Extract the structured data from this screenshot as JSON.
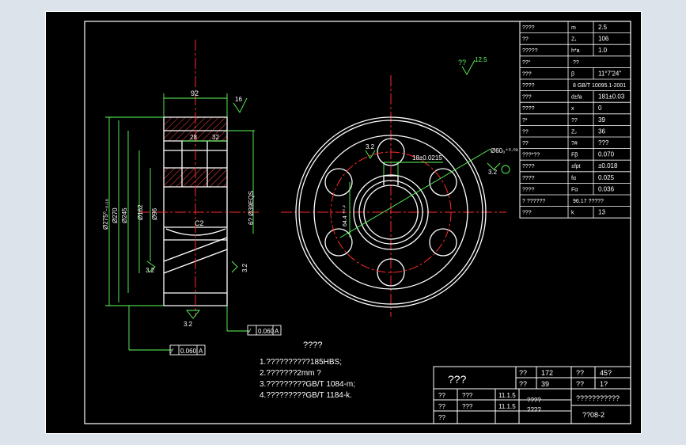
{
  "colors": {
    "background": "#000000",
    "outline": "#ffffff",
    "dimension": "#5cff5c",
    "centerline": "#ff2a2a",
    "canvas": "#dde3ea"
  },
  "params": {
    "rows": [
      {
        "label": "????",
        "sym": "m",
        "val": "2.5"
      },
      {
        "label": "??",
        "sym": "Z₁",
        "val": "106"
      },
      {
        "label": "?????",
        "sym": "h*a",
        "val": "1.0"
      },
      {
        "label": "??°",
        "sym": "",
        "val": "??"
      },
      {
        "label": "???",
        "sym": "β",
        "val": "11°7'24\""
      },
      {
        "label": "????",
        "sym": "",
        "val": "8 GB/T 10095.1-2001"
      },
      {
        "label": "???",
        "sym": "d±fa",
        "val": "181±0.03"
      },
      {
        "label": "????",
        "sym": "x",
        "val": "0"
      },
      {
        "label": "?*",
        "sym": "??",
        "val": "39"
      },
      {
        "label": "??",
        "sym": "Z₂",
        "val": "36"
      },
      {
        "label": "??",
        "sym": "?#",
        "val": "???"
      },
      {
        "label": "???*??",
        "sym": "Fβ",
        "val": "0.070"
      },
      {
        "label": "????",
        "sym": "±fpt",
        "val": "±0.018"
      },
      {
        "label": "????",
        "sym": "fα",
        "val": "0.025"
      },
      {
        "label": "????",
        "sym": "Fα",
        "val": "0.036"
      },
      {
        "label": "? ??????",
        "sym": "",
        "val": "96.17 ?????"
      },
      {
        "label": "???",
        "sym": "k",
        "val": "13"
      }
    ]
  },
  "dims": {
    "width_92": "92",
    "d16": "16",
    "d28": "28",
    "d32": "32",
    "dia_275": "Ø275⁰₋₀.₂₉",
    "dia_270": "Ø270",
    "dia_245": "Ø245",
    "dia_162": "Ø162",
    "dia_96": "Ø96",
    "dia_60": "Ø60₀⁺⁰·⁰³",
    "bore_label": "Ø39.05 EQS",
    "c2": "C2",
    "slot": "18±0.0215",
    "rough_32_a": "3.2",
    "rough_32_b": "3.2",
    "rough_32_c": "3.2",
    "rough_32_d": "3.2",
    "rough_32_e": "3.2",
    "rough_125": "12.5",
    "rough_top": "??",
    "fcf_1": "0.060",
    "fcf_a1": "A",
    "fcf_2": "0.060",
    "fcf_a2": "A",
    "tol_64": "64.4 ⁺⁰·²",
    "h6": "6? Ø39EQS"
  },
  "notes": {
    "title": "????",
    "items": [
      "1.??????????185HBS;",
      "2.???????2mm ?",
      "3.?????????GB/T 1084-m;",
      "4.?????????GB/T 1184-k."
    ]
  },
  "titleblock": {
    "name": "???",
    "c1": "??",
    "c2": "172",
    "c3": "??",
    "c4": "45?",
    "c5": "??",
    "c6": "39",
    "c7": "??",
    "c8": "1?",
    "r1a": "??",
    "r1b": "???",
    "r1c": "11.1.5",
    "r2a": "??",
    "r2b": "???",
    "r2c": "11.1.5",
    "r3a": "??",
    "school_a": "????",
    "school_b": "????",
    "drawing_name": "???????????",
    "drawing_no": "??08-2"
  }
}
